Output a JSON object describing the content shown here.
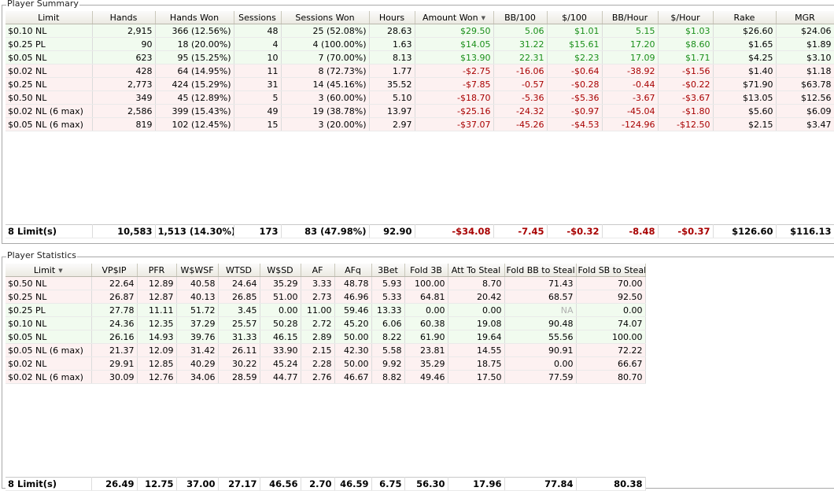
{
  "summary": {
    "title": "Player Summary",
    "headers": [
      "Limit",
      "Hands",
      "Hands Won",
      "Sessions",
      "Sessions Won",
      "Hours",
      "Amount Won",
      "BB/100",
      "$/100",
      "BB/Hour",
      "$/Hour",
      "Rake",
      "MGR"
    ],
    "sorted_column": "Amount Won",
    "rows": [
      {
        "tint": "g",
        "cells": [
          "$0.10 NL",
          "2,915",
          "366 (12.56%)",
          "48",
          "25 (52.08%)",
          "28.63",
          "$29.50",
          "5.06",
          "$1.01",
          "5.15",
          "$1.03",
          "$26.60",
          "$24.06"
        ]
      },
      {
        "tint": "g",
        "cells": [
          "$0.25 PL",
          "90",
          "18 (20.00%)",
          "4",
          "4 (100.00%)",
          "1.63",
          "$14.05",
          "31.22",
          "$15.61",
          "17.20",
          "$8.60",
          "$1.65",
          "$1.89"
        ]
      },
      {
        "tint": "g",
        "cells": [
          "$0.05 NL",
          "623",
          "95 (15.25%)",
          "10",
          "7 (70.00%)",
          "8.13",
          "$13.90",
          "22.31",
          "$2.23",
          "17.09",
          "$1.71",
          "$4.25",
          "$3.10"
        ]
      },
      {
        "tint": "r",
        "cells": [
          "$0.02 NL",
          "428",
          "64 (14.95%)",
          "11",
          "8 (72.73%)",
          "1.77",
          "-$2.75",
          "-16.06",
          "-$0.64",
          "-38.92",
          "-$1.56",
          "$1.40",
          "$1.18"
        ]
      },
      {
        "tint": "r",
        "cells": [
          "$0.25 NL",
          "2,773",
          "424 (15.29%)",
          "31",
          "14 (45.16%)",
          "35.52",
          "-$7.85",
          "-0.57",
          "-$0.28",
          "-0.44",
          "-$0.22",
          "$71.90",
          "$63.78"
        ]
      },
      {
        "tint": "r",
        "cells": [
          "$0.50 NL",
          "349",
          "45 (12.89%)",
          "5",
          "3 (60.00%)",
          "5.10",
          "-$18.70",
          "-5.36",
          "-$5.36",
          "-3.67",
          "-$3.67",
          "$13.05",
          "$12.56"
        ]
      },
      {
        "tint": "r",
        "cells": [
          "$0.02 NL (6 max)",
          "2,586",
          "399 (15.43%)",
          "49",
          "19 (38.78%)",
          "13.97",
          "-$25.16",
          "-24.32",
          "-$0.97",
          "-45.04",
          "-$1.80",
          "$5.60",
          "$6.09"
        ]
      },
      {
        "tint": "r",
        "cells": [
          "$0.05 NL (6 max)",
          "819",
          "102 (12.45%)",
          "15",
          "3 (20.00%)",
          "2.97",
          "-$37.07",
          "-45.26",
          "-$4.53",
          "-124.96",
          "-$12.50",
          "$2.15",
          "$3.47"
        ]
      }
    ],
    "total": [
      "8 Limit(s)",
      "10,583",
      "1,513 (14.30%)",
      "173",
      "83 (47.98%)",
      "92.90",
      "-$34.08",
      "-7.45",
      "-$0.32",
      "-8.48",
      "-$0.37",
      "$126.60",
      "$116.13"
    ]
  },
  "stats": {
    "title": "Player Statistics",
    "headers": [
      "Limit",
      "VP$IP",
      "PFR",
      "W$WSF",
      "WTSD",
      "W$SD",
      "AF",
      "AFq",
      "3Bet",
      "Fold 3B",
      "Att To Steal",
      "Fold BB to Steal",
      "Fold SB to Steal"
    ],
    "sorted_column": "Limit",
    "rows": [
      {
        "tint": "r",
        "cells": [
          "$0.50 NL",
          "22.64",
          "12.89",
          "40.58",
          "24.64",
          "35.29",
          "3.33",
          "48.78",
          "5.93",
          "100.00",
          "8.70",
          "71.43",
          "70.00"
        ]
      },
      {
        "tint": "r",
        "cells": [
          "$0.25 NL",
          "26.87",
          "12.87",
          "40.13",
          "26.85",
          "51.00",
          "2.73",
          "46.96",
          "5.33",
          "64.81",
          "20.42",
          "68.57",
          "92.50"
        ]
      },
      {
        "tint": "g",
        "cells": [
          "$0.25 PL",
          "27.78",
          "11.11",
          "51.72",
          "3.45",
          "0.00",
          "11.00",
          "59.46",
          "13.33",
          "0.00",
          "0.00",
          "NA",
          "0.00"
        ]
      },
      {
        "tint": "g",
        "cells": [
          "$0.10 NL",
          "24.36",
          "12.35",
          "37.29",
          "25.57",
          "50.28",
          "2.72",
          "45.20",
          "6.06",
          "60.38",
          "19.08",
          "90.48",
          "74.07"
        ]
      },
      {
        "tint": "g",
        "cells": [
          "$0.05 NL",
          "26.16",
          "14.93",
          "39.76",
          "31.33",
          "46.15",
          "2.89",
          "50.00",
          "8.22",
          "61.90",
          "19.64",
          "55.56",
          "100.00"
        ]
      },
      {
        "tint": "r",
        "cells": [
          "$0.05 NL (6 max)",
          "21.37",
          "12.09",
          "31.42",
          "26.11",
          "33.90",
          "2.15",
          "42.30",
          "5.58",
          "23.81",
          "14.55",
          "90.91",
          "72.22"
        ]
      },
      {
        "tint": "r",
        "cells": [
          "$0.02 NL",
          "29.91",
          "12.85",
          "40.29",
          "30.22",
          "45.24",
          "2.28",
          "50.00",
          "9.92",
          "35.29",
          "18.75",
          "0.00",
          "66.67"
        ]
      },
      {
        "tint": "r",
        "cells": [
          "$0.02 NL (6 max)",
          "30.09",
          "12.76",
          "34.06",
          "28.59",
          "44.77",
          "2.76",
          "46.67",
          "8.82",
          "49.46",
          "17.50",
          "77.59",
          "80.70"
        ]
      }
    ],
    "total": [
      "8 Limit(s)",
      "26.49",
      "12.75",
      "37.00",
      "27.17",
      "46.56",
      "2.70",
      "46.59",
      "6.75",
      "56.30",
      "17.96",
      "77.84",
      "80.38"
    ]
  },
  "colors": {
    "positive": "#1a8f1a",
    "negative": "#a80000",
    "green_row": "#f1fbef",
    "red_row": "#fdf1f1"
  }
}
